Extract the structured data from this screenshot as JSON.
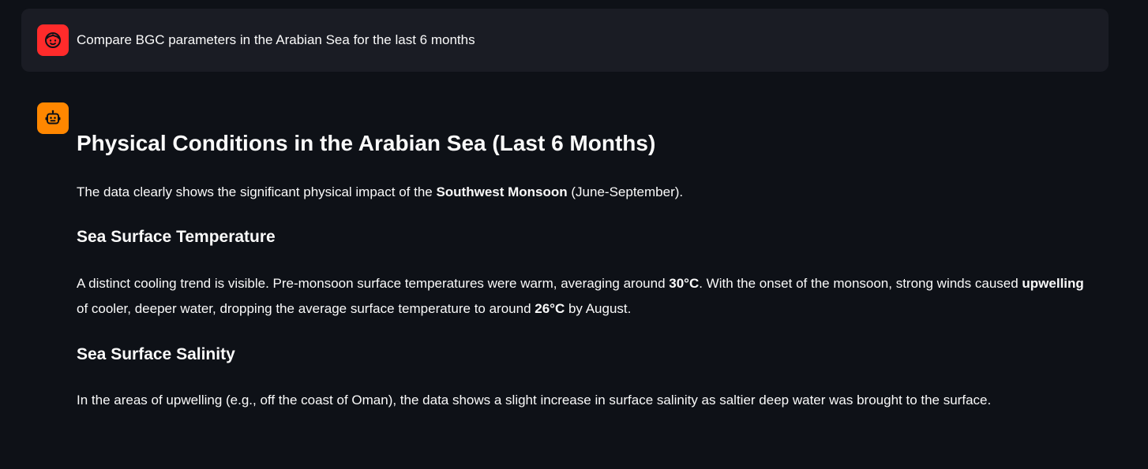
{
  "user_message": {
    "avatar_icon": "user-face-icon",
    "text": "Compare BGC parameters in the Arabian Sea for the last 6 months"
  },
  "assistant_message": {
    "avatar_icon": "robot-icon",
    "title": "Physical Conditions in the Arabian Sea (Last 6 Months)",
    "intro": {
      "before": "The data clearly shows the significant physical impact of the ",
      "bold": "Southwest Monsoon",
      "after": " (June-September)."
    },
    "temperature": {
      "heading": "Sea Surface Temperature",
      "p1": "A distinct cooling trend is visible. Pre-monsoon surface temperatures were warm, averaging around ",
      "b1": "30°C",
      "p2": ". With the onset of the monsoon, strong winds caused ",
      "b2": "upwelling",
      "p3": " of cooler, deeper water, dropping the average surface temperature to around ",
      "b3": "26°C",
      "p4": " by August."
    },
    "salinity": {
      "heading": "Sea Surface Salinity",
      "text": "In the areas of upwelling (e.g., off the coast of Oman), the data shows a slight increase in surface salinity as saltier deep water was brought to the surface."
    }
  },
  "colors": {
    "background": "#0e1117",
    "user_bubble": "#1a1c24",
    "user_avatar": "#ff2b2b",
    "assistant_avatar": "#ff8700",
    "text": "#fafafa"
  }
}
